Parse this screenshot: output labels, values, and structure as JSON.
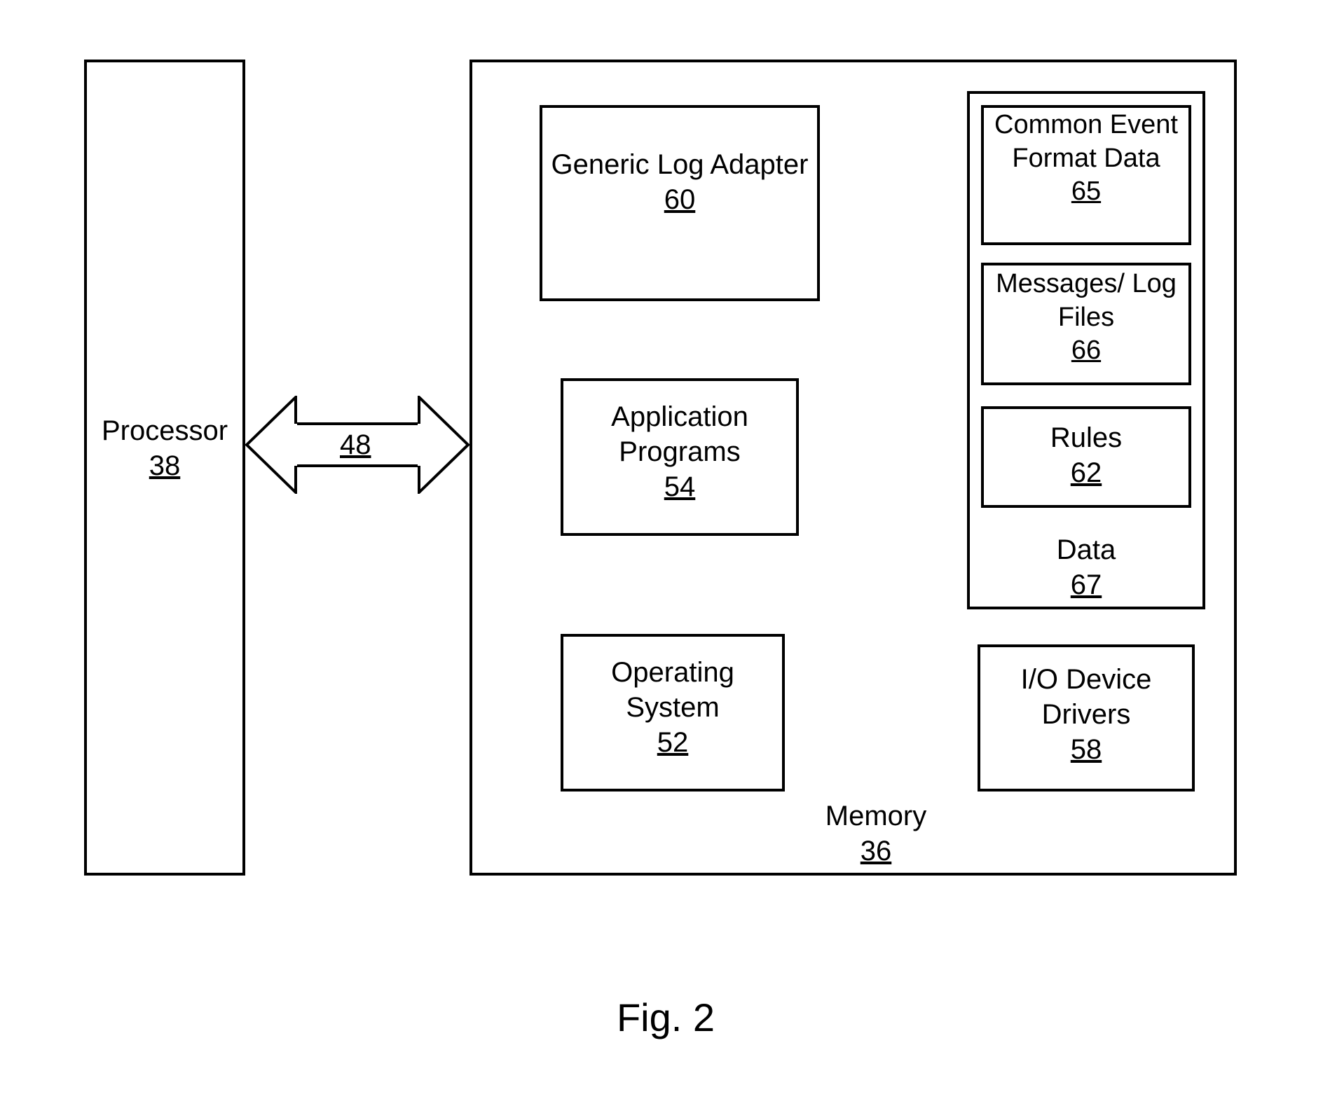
{
  "figure_label": "Fig. 2",
  "arrow": {
    "ref": "48"
  },
  "processor": {
    "label": "Processor",
    "ref": "38"
  },
  "memory": {
    "label": "Memory",
    "ref": "36",
    "generic_log_adapter": {
      "label": "Generic Log Adapter",
      "ref": "60"
    },
    "application_programs": {
      "label": "Application Programs",
      "ref": "54"
    },
    "operating_system": {
      "label": "Operating System",
      "ref": "52"
    },
    "io_device_drivers": {
      "label": "I/O Device Drivers",
      "ref": "58"
    },
    "data_block": {
      "label": "Data",
      "ref": "67",
      "common_event_format_data": {
        "label": "Common Event Format Data",
        "ref": "65"
      },
      "messages_log_files": {
        "label": "Messages/ Log Files",
        "ref": "66"
      },
      "rules": {
        "label": "Rules",
        "ref": "62"
      }
    }
  }
}
